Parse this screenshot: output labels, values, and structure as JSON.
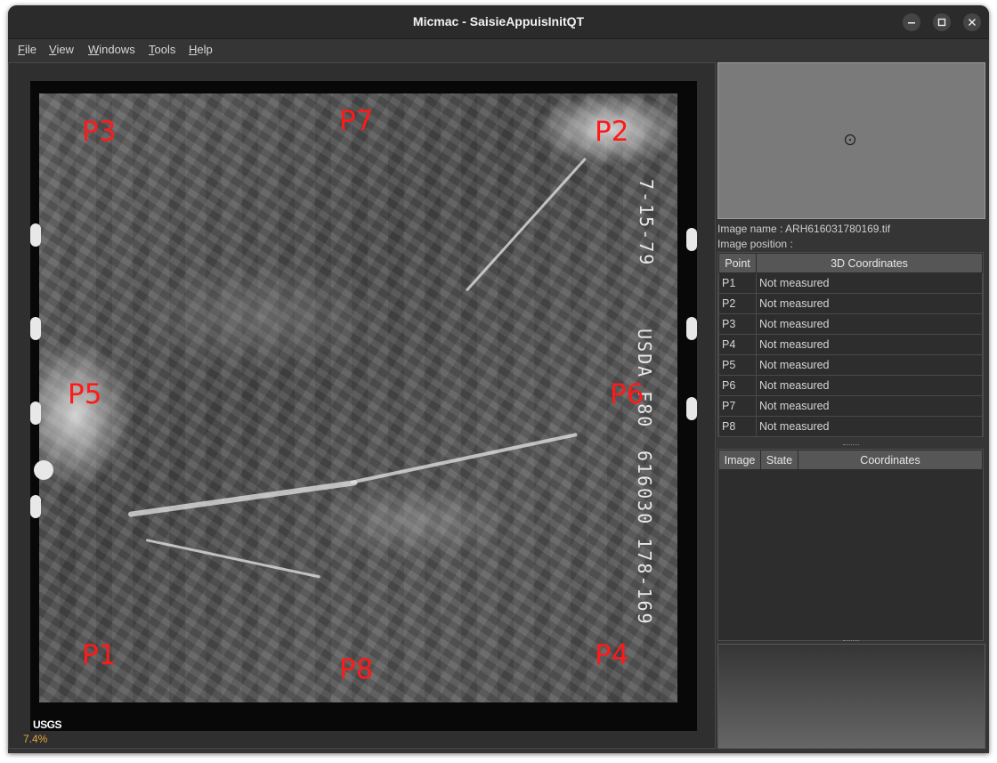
{
  "window": {
    "title": "Micmac - SaisieAppuisInitQT",
    "controls": [
      "minimize-icon",
      "maximize-icon",
      "close-icon"
    ]
  },
  "menu": {
    "file": {
      "mnemonic": "F",
      "rest": "ile"
    },
    "view": {
      "mnemonic": "V",
      "rest": "iew"
    },
    "windows": {
      "mnemonic": "W",
      "rest": "indows"
    },
    "tools": {
      "mnemonic": "T",
      "rest": "ools"
    },
    "help": {
      "mnemonic": "H",
      "rest": "elp"
    }
  },
  "viewer": {
    "points": {
      "p1": "P1",
      "p2": "P2",
      "p3": "P3",
      "p4": "P4",
      "p5": "P5",
      "p6": "P6",
      "p7": "P7",
      "p8": "P8"
    },
    "film_text_top": "7-15-79",
    "film_text_mid": "USDA F80",
    "film_text_bottom": "616030 178-169",
    "logo": "USGS",
    "zoom": "7.4%"
  },
  "info": {
    "image_name": "Image name : ARH616031780169.tif",
    "image_position": "Image position :"
  },
  "points_table": {
    "headers": {
      "point": "Point",
      "coords": "3D Coordinates"
    },
    "rows": [
      {
        "point": "P1",
        "coords": "Not measured"
      },
      {
        "point": "P2",
        "coords": "Not measured"
      },
      {
        "point": "P3",
        "coords": "Not measured"
      },
      {
        "point": "P4",
        "coords": "Not measured"
      },
      {
        "point": "P5",
        "coords": "Not measured"
      },
      {
        "point": "P6",
        "coords": "Not measured"
      },
      {
        "point": "P7",
        "coords": "Not measured"
      },
      {
        "point": "P8",
        "coords": "Not measured"
      }
    ]
  },
  "images_table": {
    "headers": {
      "image": "Image",
      "state": "State",
      "coords": "Coordinates"
    }
  },
  "colors": {
    "point_label": "#ff1a1a",
    "zoom_text": "#e8a43c",
    "window_bg": "#353535"
  }
}
